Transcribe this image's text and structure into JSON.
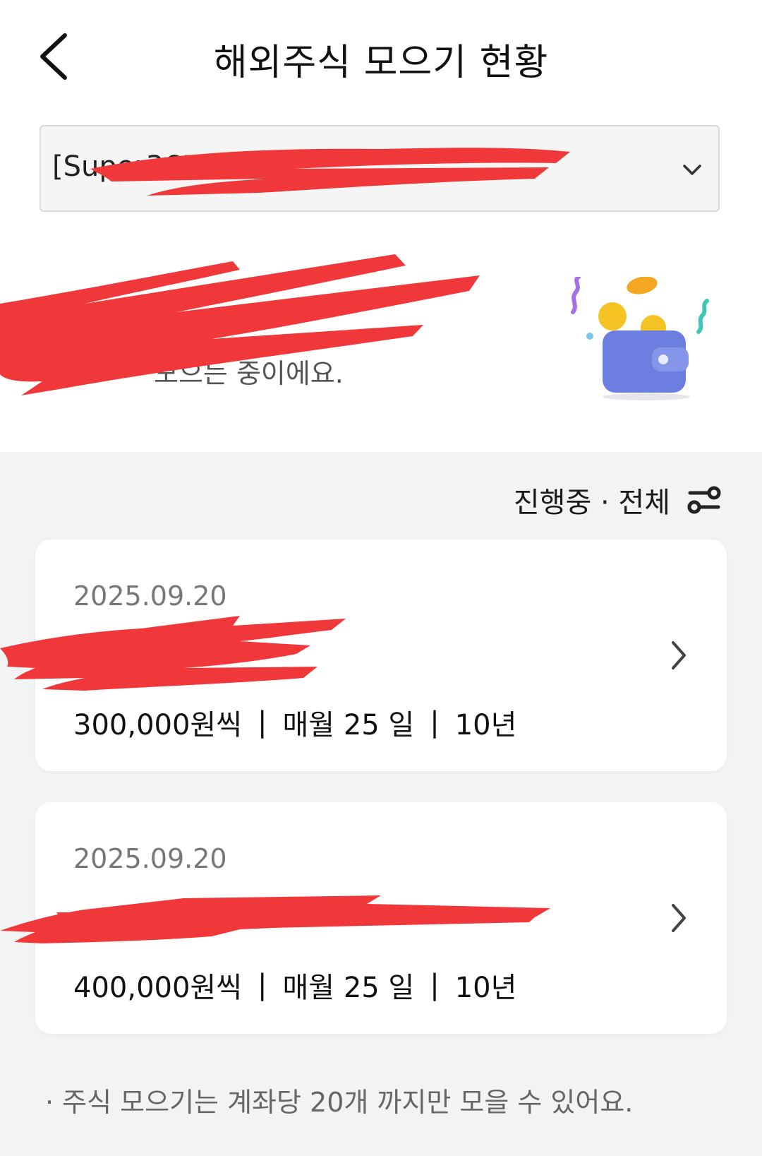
{
  "header": {
    "title": "해외주식 모으기 현황"
  },
  "account_selector": {
    "visible_text": "[Super365]"
  },
  "summary": {
    "subtitle": "모으는 중이에요."
  },
  "filter": {
    "label": "진행중 · 전체"
  },
  "plans": [
    {
      "date": "2025.09.20",
      "name": "",
      "amount": "300,000원씩",
      "schedule": "매월 25 일",
      "duration": "10년"
    },
    {
      "date": "2025.09.20",
      "name": "",
      "amount": "400,000원씩",
      "schedule": "매월 25 일",
      "duration": "10년"
    }
  ],
  "notice": "· 주식 모으기는 계좌당 20개 까지만 모을 수 있어요.",
  "colors": {
    "redaction": "#f0383a",
    "section_bg": "#f2f3f5",
    "wallet": "#6c7fe0",
    "coin": "#f5c324"
  },
  "icons": {
    "back": "back-arrow-icon",
    "dropdown": "chevron-down-icon",
    "filter": "filter-sliders-icon",
    "row": "chevron-right-icon",
    "illustration": "wallet-coins-illustration"
  }
}
